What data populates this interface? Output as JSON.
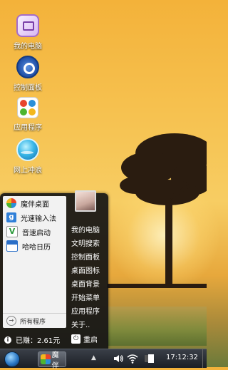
{
  "desktop": {
    "icons": [
      {
        "label": "我的电脑",
        "icon": "computer-icon"
      },
      {
        "label": "控制面板",
        "icon": "control-panel-icon"
      },
      {
        "label": "应用程序",
        "icon": "applications-icon"
      },
      {
        "label": "网上冲浪",
        "icon": "browser-icon"
      }
    ]
  },
  "start_menu": {
    "programs": [
      {
        "label": "魔伴桌面",
        "icon": "mobandesktop-icon"
      },
      {
        "label": "光速输入法",
        "icon": "input-method-icon"
      },
      {
        "label": "音速启动",
        "icon": "quick-launch-icon"
      },
      {
        "label": "哈哈日历",
        "icon": "calendar-icon"
      }
    ],
    "all_programs": "所有程序",
    "right_items": [
      "我的电脑",
      "文明搜索",
      "控制面板",
      "桌面图标",
      "桌面背景",
      "开始菜单",
      "应用程序",
      "关于.."
    ],
    "earned": "已赚：2.61元",
    "restart": "重启"
  },
  "taskbar": {
    "app_label": "魔伴",
    "clock": "17:12:32",
    "tray_icons": [
      "chevron-up-icon",
      "volume-icon",
      "wifi-icon",
      "battery-icon"
    ]
  },
  "colors": {
    "accent_blue": "#2b78c5",
    "menu_bg": "#161616",
    "left_pane_bg": "#f2f2f2"
  }
}
